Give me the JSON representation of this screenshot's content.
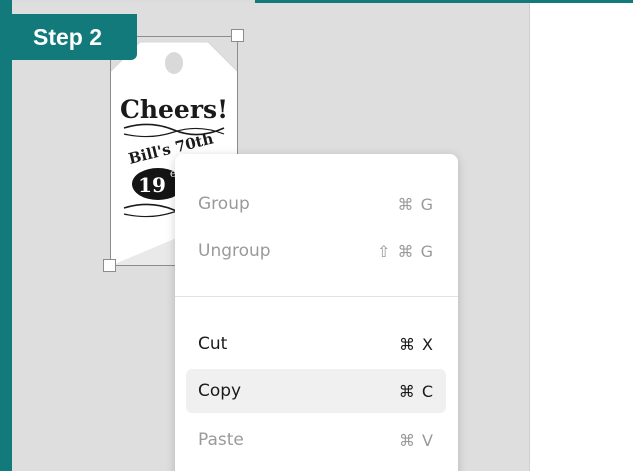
{
  "step_badge": "Step 2",
  "tag": {
    "heading": "Cheers!",
    "name_text": "Bill's 70th",
    "year_partial": "19",
    "est_partial": "es"
  },
  "context_menu": {
    "items": [
      {
        "label": "Group",
        "shortcut": "⌘ G",
        "enabled": false
      },
      {
        "label": "Ungroup",
        "shortcut": "⇧ ⌘ G",
        "enabled": false
      },
      {
        "label": "Cut",
        "shortcut": "⌘ X",
        "enabled": true
      },
      {
        "label": "Copy",
        "shortcut": "⌘ C",
        "enabled": true,
        "hovered": true
      },
      {
        "label": "Paste",
        "shortcut": "⌘ V",
        "enabled": false
      }
    ]
  },
  "colors": {
    "accent": "#127a7a",
    "canvas": "#dedede",
    "disabled_text": "#9a9a9a",
    "hover_bg": "#f0f0f0"
  }
}
